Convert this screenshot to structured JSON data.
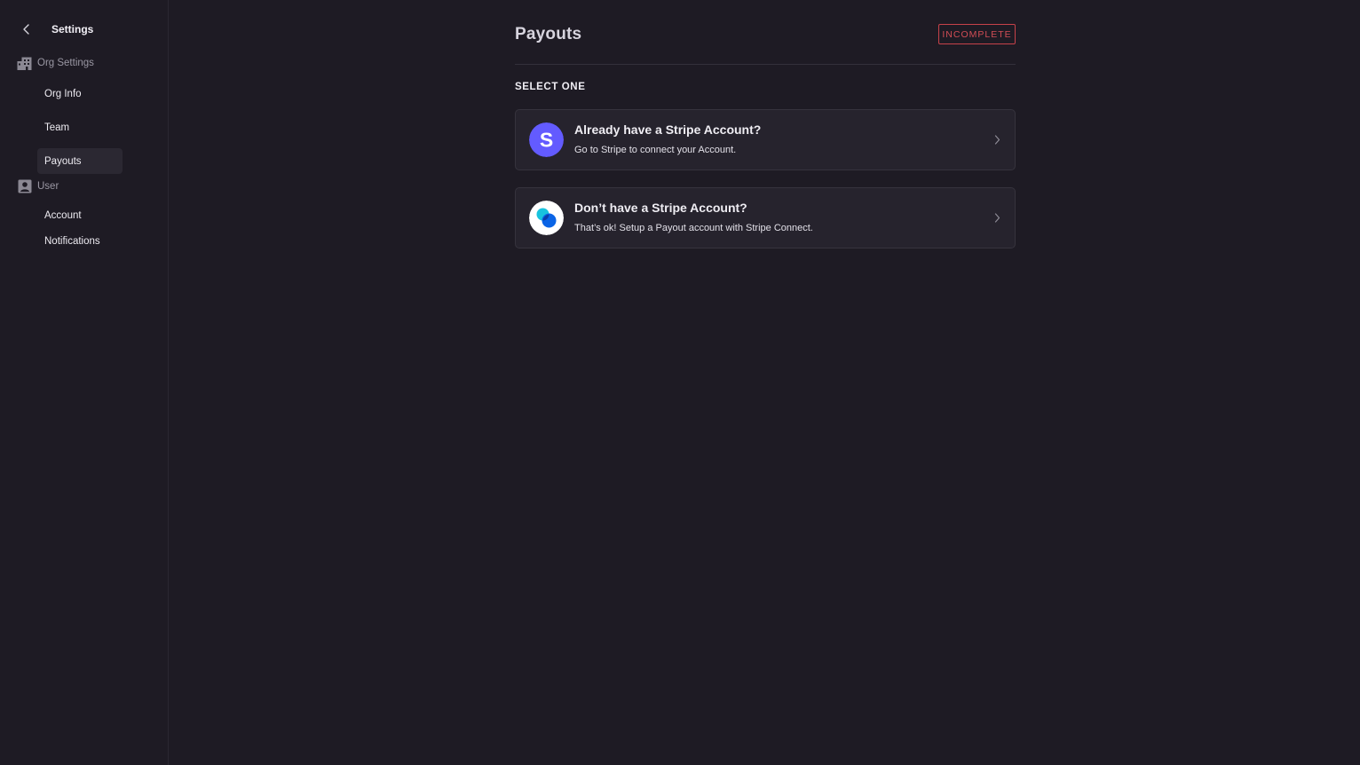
{
  "sidebar": {
    "title": "Settings",
    "sections": [
      {
        "label": "Org Settings",
        "icon": "building-icon"
      },
      {
        "label": "User",
        "icon": "user-badge-icon"
      }
    ],
    "items": [
      {
        "label": "Org Info"
      },
      {
        "label": "Team"
      },
      {
        "label": "Payouts",
        "active": true
      },
      {
        "label": "Account"
      },
      {
        "label": "Notifications"
      }
    ]
  },
  "main": {
    "title": "Payouts",
    "status": "INCOMPLETE",
    "section_label": "SELECT ONE",
    "options": [
      {
        "title": "Already have a Stripe Account?",
        "description": "Go to Stripe to connect your Account.",
        "icon": "stripe-s-logo-icon"
      },
      {
        "title": "Don’t have a Stripe Account?",
        "description": "That’s ok! Setup a Payout account with Stripe Connect.",
        "icon": "stripe-connect-logo-icon"
      }
    ]
  },
  "colors": {
    "background": "#1e1b24",
    "card": "#26232d",
    "status_red": "#d14d55",
    "stripe_purple": "#635bff"
  }
}
